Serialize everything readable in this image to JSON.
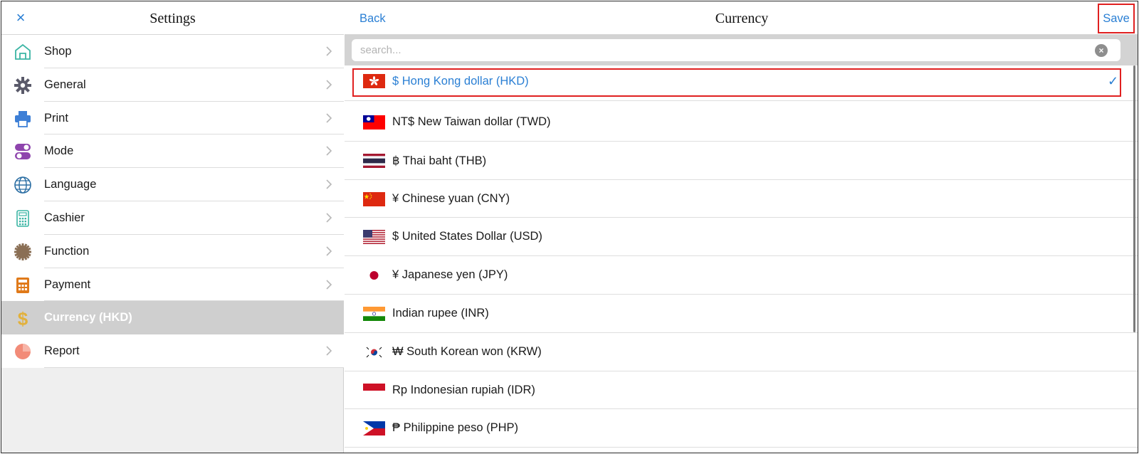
{
  "left": {
    "title": "Settings",
    "close_label": "×",
    "menu": [
      {
        "label": "Shop",
        "icon": "shop-icon",
        "color": "#3bb5a4"
      },
      {
        "label": "General",
        "icon": "gear-icon",
        "color": "#5a5a6a"
      },
      {
        "label": "Print",
        "icon": "printer-icon",
        "color": "#3d7fd6"
      },
      {
        "label": "Mode",
        "icon": "mode-toggle-icon",
        "color": "#8e44ad"
      },
      {
        "label": "Language",
        "icon": "globe-icon",
        "color": "#2b6ea3"
      },
      {
        "label": "Cashier",
        "icon": "calculator-icon",
        "color": "#3bb5a4"
      },
      {
        "label": "Function",
        "icon": "function-icon",
        "color": "#8a6f55"
      },
      {
        "label": "Payment",
        "icon": "payment-calculator-icon",
        "color": "#e07a1a"
      },
      {
        "label": "Currency (HKD)",
        "icon": "dollar-icon",
        "color": "#e2b13c",
        "active": true
      },
      {
        "label": "Report",
        "icon": "pie-chart-icon",
        "color": "#f28b78"
      }
    ]
  },
  "right": {
    "title": "Currency",
    "back_label": "Back",
    "save_label": "Save",
    "search_placeholder": "search...",
    "clear_label": "×",
    "check_label": "✓",
    "currencies": [
      {
        "label": "$ Hong Kong dollar (HKD)",
        "flag": "HK",
        "selected": true
      },
      {
        "label": "NT$ New Taiwan dollar (TWD)",
        "flag": "TW"
      },
      {
        "label": "฿ Thai baht (THB)",
        "flag": "TH"
      },
      {
        "label": "¥ Chinese yuan (CNY)",
        "flag": "CN"
      },
      {
        "label": "$ United States Dollar (USD)",
        "flag": "US"
      },
      {
        "label": "¥ Japanese yen (JPY)",
        "flag": "JP"
      },
      {
        "label": "Indian rupee (INR)",
        "flag": "IN"
      },
      {
        "label": "₩ South Korean won (KRW)",
        "flag": "KR"
      },
      {
        "label": "Rp Indonesian rupiah (IDR)",
        "flag": "ID"
      },
      {
        "label": "₱ Philippine peso (PHP)",
        "flag": "PH"
      }
    ]
  },
  "colors": {
    "accent": "#2a7fd4",
    "highlight_box": "#e02020",
    "active_row": "#cfcfcf"
  }
}
